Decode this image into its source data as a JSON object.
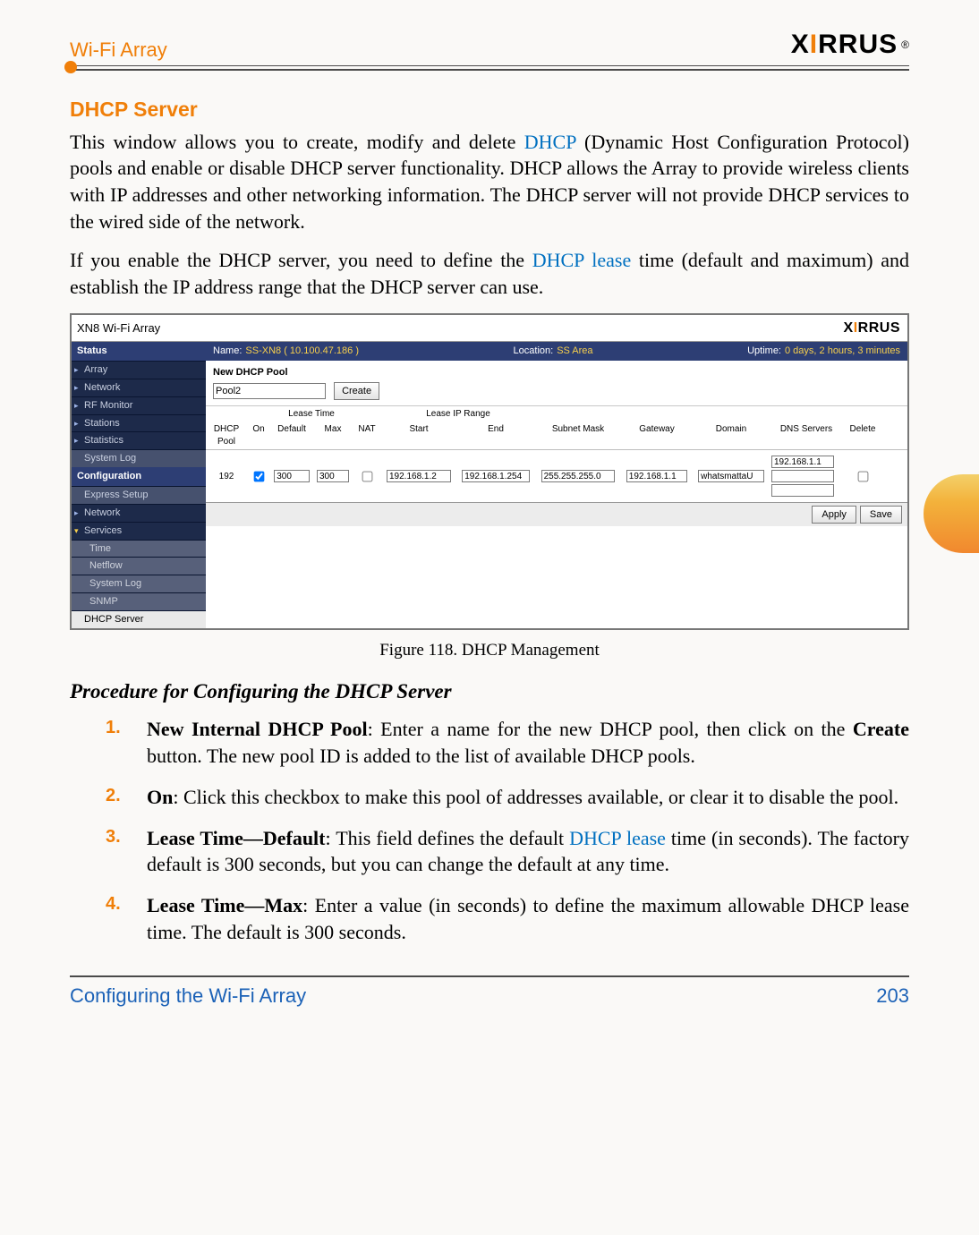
{
  "header": {
    "product": "Wi-Fi Array",
    "logo_text": "XIRRUS",
    "logo_reg": "®"
  },
  "section_title": "DHCP Server",
  "para1_a": "This window allows you to create, modify and delete ",
  "para1_link1": "DHCP",
  "para1_b": " (Dynamic Host Configuration Protocol) pools and enable or disable DHCP server functionality. DHCP allows the Array to provide wireless clients with IP addresses and other networking information. The DHCP server will not provide DHCP services to the wired side of the network.",
  "para2_a": "If you enable the DHCP server, you need to define the ",
  "para2_link1": "DHCP lease",
  "para2_b": " time (default and maximum) and establish the IP address range that the DHCP server can use.",
  "figure_caption": "Figure 118. DHCP Management",
  "procedure_title": "Procedure for Configuring the DHCP Server",
  "steps": [
    {
      "num": "1.",
      "term": "New Internal DHCP Pool",
      "rest": ": Enter a name for the new DHCP pool, then click on the ",
      "bold2": "Create",
      "rest2": " button. The new pool ID is added to the list of available DHCP pools."
    },
    {
      "num": "2.",
      "term": "On",
      "rest": ": Click this checkbox to make this pool of addresses available, or clear it to disable the pool."
    },
    {
      "num": "3.",
      "term": "Lease Time—Default",
      "rest": ": This field defines the default ",
      "link": "DHCP lease",
      "rest2": " time (in seconds). The factory default is 300 seconds, but you can change the default at any time."
    },
    {
      "num": "4.",
      "term": "Lease Time—Max",
      "rest": ": Enter a value (in seconds) to define the maximum allowable DHCP lease time. The default is 300 seconds."
    }
  ],
  "footer": {
    "left": "Configuring the Wi-Fi Array",
    "right": "203"
  },
  "ui": {
    "title": "XN8 Wi-Fi Array",
    "logo": "XIRRUS",
    "bar": {
      "name_k": "Name:",
      "name_v": "SS-XN8   ( 10.100.47.186 )",
      "loc_k": "Location:",
      "loc_v": "SS Area",
      "up_k": "Uptime:",
      "up_v": "0 days, 2 hours, 3 minutes"
    },
    "nav": {
      "status": "Status",
      "items_status": [
        "Array",
        "Network",
        "RF Monitor",
        "Stations",
        "Statistics",
        "System Log"
      ],
      "config": "Configuration",
      "items_config": [
        "Express Setup",
        "Network",
        "Services"
      ],
      "items_services": [
        "Time",
        "Netflow",
        "System Log",
        "SNMP",
        "DHCP Server"
      ]
    },
    "new_pool_label": "New DHCP Pool",
    "new_pool_value": "Pool2",
    "create_btn": "Create",
    "grid_top": {
      "lease": "Lease Time",
      "range": "Lease IP Range"
    },
    "cols": {
      "pool": "DHCP Pool",
      "on": "On",
      "def": "Default",
      "max": "Max",
      "nat": "NAT",
      "start": "Start",
      "end": "End",
      "mask": "Subnet Mask",
      "gw": "Gateway",
      "domain": "Domain",
      "dns": "DNS Servers",
      "del": "Delete"
    },
    "row": {
      "pool": "192",
      "on": true,
      "def": "300",
      "max": "300",
      "nat": false,
      "start": "192.168.1.2",
      "end": "192.168.1.254",
      "mask": "255.255.255.0",
      "gw": "192.168.1.1",
      "domain": "whatsmattaU",
      "dns1": "192.168.1.1",
      "dns2": "",
      "dns3": "",
      "del": false
    },
    "apply": "Apply",
    "save": "Save"
  }
}
